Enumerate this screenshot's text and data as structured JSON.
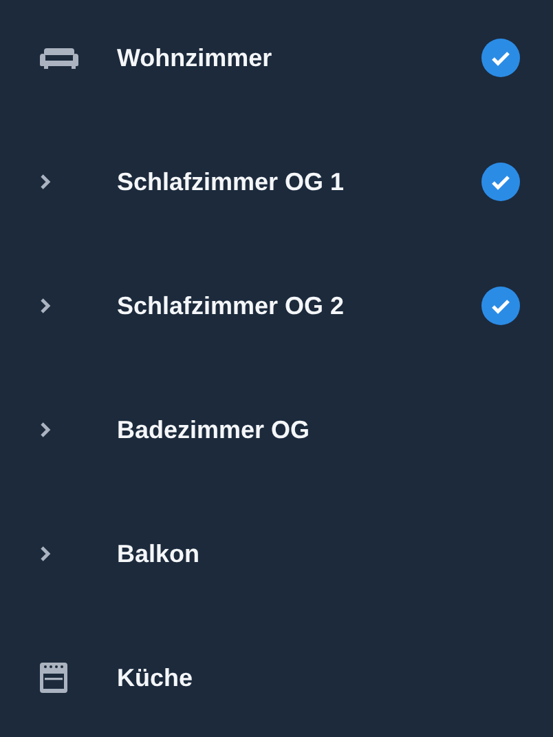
{
  "rooms": [
    {
      "name": "Wohnzimmer",
      "kind": "sofa",
      "checked": true
    },
    {
      "name": "Schlafzimmer OG 1",
      "kind": "expander",
      "checked": true
    },
    {
      "name": "Schlafzimmer OG 2",
      "kind": "expander",
      "checked": true
    },
    {
      "name": "Badezimmer OG",
      "kind": "expander",
      "checked": false
    },
    {
      "name": "Balkon",
      "kind": "expander",
      "checked": false
    },
    {
      "name": "Küche",
      "kind": "oven",
      "checked": false
    }
  ]
}
